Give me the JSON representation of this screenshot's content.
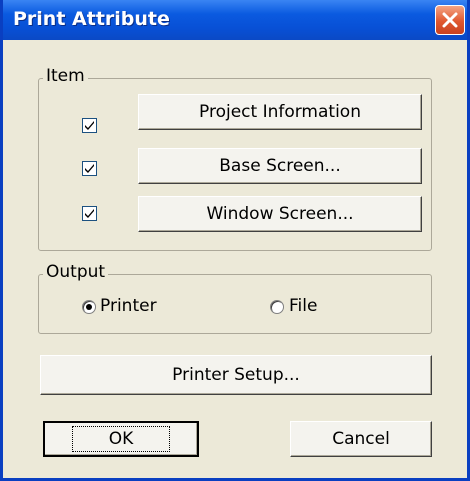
{
  "dialog": {
    "title": "Print Attribute",
    "close_icon": "close-icon"
  },
  "item_group": {
    "label": "Item",
    "rows": [
      {
        "checked": true,
        "button_label": "Project Information"
      },
      {
        "checked": true,
        "button_label": "Base Screen..."
      },
      {
        "checked": true,
        "button_label": "Window Screen..."
      }
    ]
  },
  "output_group": {
    "label": "Output",
    "options": [
      {
        "label": "Printer",
        "selected": true
      },
      {
        "label": "File",
        "selected": false
      }
    ]
  },
  "buttons": {
    "printer_setup": "Printer Setup...",
    "ok": "OK",
    "cancel": "Cancel"
  }
}
